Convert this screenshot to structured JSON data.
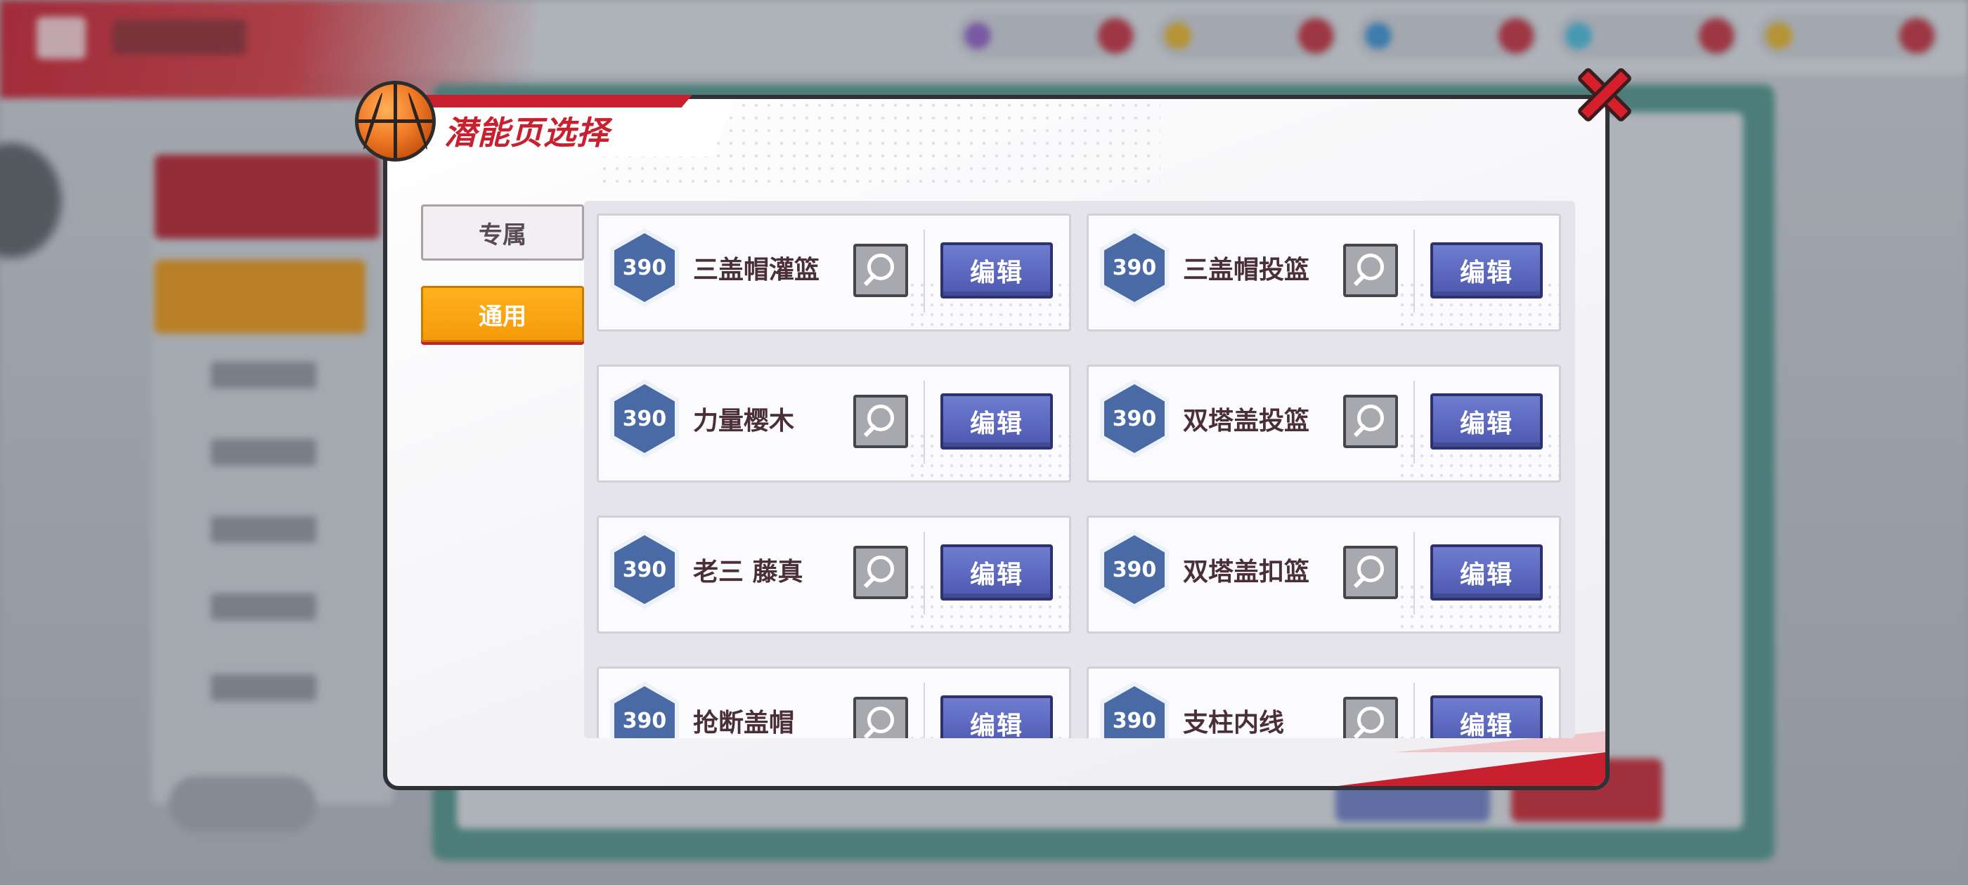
{
  "dialog": {
    "title": "潜能页选择"
  },
  "tabs": [
    {
      "label": "专属",
      "active": false
    },
    {
      "label": "通用",
      "active": true
    }
  ],
  "cards": [
    {
      "score": "390",
      "name": "三盖帽灌篮",
      "edit_label": "编辑"
    },
    {
      "score": "390",
      "name": "三盖帽投篮",
      "edit_label": "编辑"
    },
    {
      "score": "390",
      "name": "力量樱木",
      "edit_label": "编辑"
    },
    {
      "score": "390",
      "name": "双塔盖投篮",
      "edit_label": "编辑"
    },
    {
      "score": "390",
      "name": "老三 藤真",
      "edit_label": "编辑"
    },
    {
      "score": "390",
      "name": "双塔盖扣篮",
      "edit_label": "编辑"
    },
    {
      "score": "390",
      "name": "抢断盖帽",
      "edit_label": "编辑"
    },
    {
      "score": "390",
      "name": "支柱内线",
      "edit_label": "编辑"
    }
  ],
  "icons": {
    "close": "close-icon",
    "preview": "magnifier-icon",
    "header": "basketball-icon"
  },
  "colors": {
    "accent_red": "#c8202e",
    "tab_active": "#f59a08",
    "edit_button": "#5a67c0",
    "score_badge": "#4a6aa6"
  }
}
